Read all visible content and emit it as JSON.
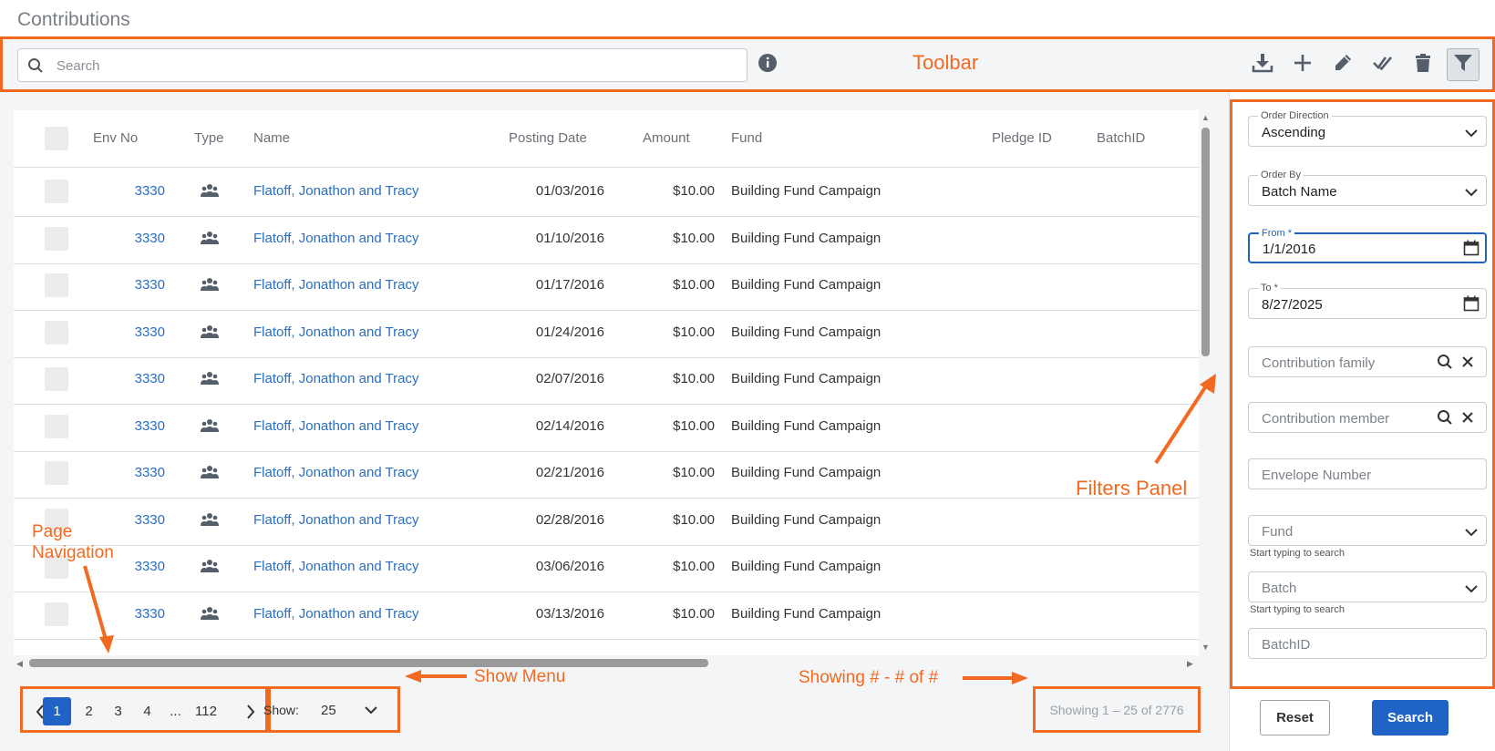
{
  "page": {
    "title": "Contributions"
  },
  "toolbar": {
    "search_placeholder": "Search",
    "annotation": "Toolbar",
    "icons": [
      "download-icon",
      "plus-icon",
      "pencil-icon",
      "double-check-icon",
      "trash-icon",
      "filter-icon"
    ]
  },
  "grid": {
    "columns": [
      "Env No",
      "Type",
      "Name",
      "Posting Date",
      "Amount",
      "Fund",
      "Pledge ID",
      "BatchID"
    ],
    "rows": [
      {
        "env": "3330",
        "type_icon": "family-icon",
        "name": "Flatoff, Jonathon and Tracy",
        "date": "01/03/2016",
        "amount": "$10.00",
        "fund": "Building Fund Campaign"
      },
      {
        "env": "3330",
        "type_icon": "family-icon",
        "name": "Flatoff, Jonathon and Tracy",
        "date": "01/10/2016",
        "amount": "$10.00",
        "fund": "Building Fund Campaign"
      },
      {
        "env": "3330",
        "type_icon": "family-icon",
        "name": "Flatoff, Jonathon and Tracy",
        "date": "01/17/2016",
        "amount": "$10.00",
        "fund": "Building Fund Campaign"
      },
      {
        "env": "3330",
        "type_icon": "family-icon",
        "name": "Flatoff, Jonathon and Tracy",
        "date": "01/24/2016",
        "amount": "$10.00",
        "fund": "Building Fund Campaign"
      },
      {
        "env": "3330",
        "type_icon": "family-icon",
        "name": "Flatoff, Jonathon and Tracy",
        "date": "02/07/2016",
        "amount": "$10.00",
        "fund": "Building Fund Campaign"
      },
      {
        "env": "3330",
        "type_icon": "family-icon",
        "name": "Flatoff, Jonathon and Tracy",
        "date": "02/14/2016",
        "amount": "$10.00",
        "fund": "Building Fund Campaign"
      },
      {
        "env": "3330",
        "type_icon": "family-icon",
        "name": "Flatoff, Jonathon and Tracy",
        "date": "02/21/2016",
        "amount": "$10.00",
        "fund": "Building Fund Campaign"
      },
      {
        "env": "3330",
        "type_icon": "family-icon",
        "name": "Flatoff, Jonathon and Tracy",
        "date": "02/28/2016",
        "amount": "$10.00",
        "fund": "Building Fund Campaign"
      },
      {
        "env": "3330",
        "type_icon": "family-icon",
        "name": "Flatoff, Jonathon and Tracy",
        "date": "03/06/2016",
        "amount": "$10.00",
        "fund": "Building Fund Campaign"
      },
      {
        "env": "3330",
        "type_icon": "family-icon",
        "name": "Flatoff, Jonathon and Tracy",
        "date": "03/13/2016",
        "amount": "$10.00",
        "fund": "Building Fund Campaign"
      }
    ]
  },
  "pagination": {
    "pages": [
      "1",
      "2",
      "3",
      "4",
      "...",
      "112"
    ],
    "active_page": "1",
    "show_label": "Show:",
    "show_value": "25",
    "showing_text": "Showing 1 – 25 of 2776"
  },
  "annotations": {
    "page_nav_line1": "Page",
    "page_nav_line2": "Navigation",
    "show_menu": "Show Menu",
    "showing": "Showing # - # of #",
    "filters_panel": "Filters Panel"
  },
  "filters": {
    "order_direction": {
      "label": "Order Direction",
      "value": "Ascending"
    },
    "order_by": {
      "label": "Order By",
      "value": "Batch Name"
    },
    "from": {
      "label": "From *",
      "value": "1/1/2016"
    },
    "to": {
      "label": "To *",
      "value": "8/27/2025"
    },
    "contribution_family": {
      "placeholder": "Contribution family"
    },
    "contribution_member": {
      "placeholder": "Contribution member"
    },
    "envelope_number": {
      "placeholder": "Envelope Number"
    },
    "fund": {
      "placeholder": "Fund",
      "hint": "Start typing to search"
    },
    "batch": {
      "placeholder": "Batch",
      "hint": "Start typing to search"
    },
    "batch_id": {
      "placeholder": "BatchID"
    },
    "reset_label": "Reset",
    "search_label": "Search"
  },
  "colors": {
    "accent": "#1f63c6",
    "annotation": "#f26a21",
    "link": "#2a6ec0"
  }
}
